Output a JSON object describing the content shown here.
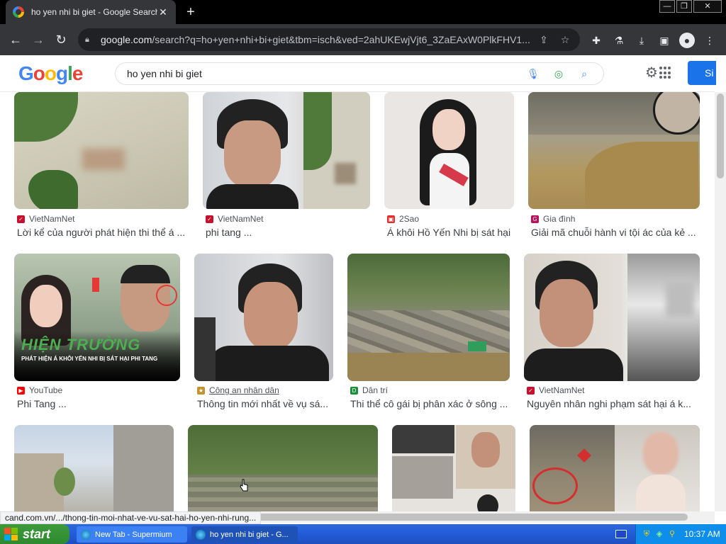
{
  "browser": {
    "tab_title": "ho yen nhi bi giet - Google Search",
    "tab_close": "✕",
    "new_tab": "+",
    "win_min": "—",
    "win_restore": "❐",
    "win_close": "✕",
    "url_host": "google.com",
    "url_path": "/search?q=ho+yen+nhi+bi+giet&tbm=isch&ved=2ahUKEwjVjt6_3ZaEAxW0PlkFHV1...",
    "back": "←",
    "forward": "→",
    "reload": "↻"
  },
  "google": {
    "logo": [
      "G",
      "o",
      "o",
      "g",
      "l",
      "e"
    ],
    "query": "ho yen nhi bi giet",
    "signin": "Si"
  },
  "results": [
    {
      "source": "VietNamNet",
      "title": "Lời kể của người phát hiện thi thể á ...",
      "source_icon": "vietnamnet-icon"
    },
    {
      "source": "VietNamNet",
      "title": "phi tang ...",
      "source_icon": "vietnamnet-icon"
    },
    {
      "source": "2Sao",
      "title": "Á khôi Hồ Yến Nhi bị sát hại",
      "source_icon": "2sao-icon"
    },
    {
      "source": "Gia đình",
      "title": "Giải mã chuỗi hành vi tội ác của kẻ ...",
      "source_icon": "giadinh-icon"
    },
    {
      "source": "YouTube",
      "title": "Phi Tang ...",
      "source_icon": "youtube-icon"
    },
    {
      "source": "Công an nhân dân",
      "title": "Thông tin mới nhất về vụ sá...",
      "source_icon": "cand-icon"
    },
    {
      "source": "Dân trí",
      "title": "Thi thể cô gái bị phân xác ở sông ...",
      "source_icon": "dantri-icon"
    },
    {
      "source": "VietNamNet",
      "title": "Nguyên nhân nghi phạm sát hại á k...",
      "source_icon": "vietnamnet-icon"
    }
  ],
  "thumb_text": {
    "hien_truong": "HIỆN TRƯỜNG",
    "hien_truong_sub": "PHÁT HIỆN Á KHÔI YẾN NHI BỊ SÁT HẠI PHI TANG"
  },
  "status_url": "cand.com.vn/.../thong-tin-moi-nhat-ve-vu-sat-hai-ho-yen-nhi-rung...",
  "taskbar": {
    "start": "start",
    "tasks": [
      "New Tab - Supermium",
      "ho yen nhi bi giet - G..."
    ],
    "clock": "10:37 AM"
  }
}
